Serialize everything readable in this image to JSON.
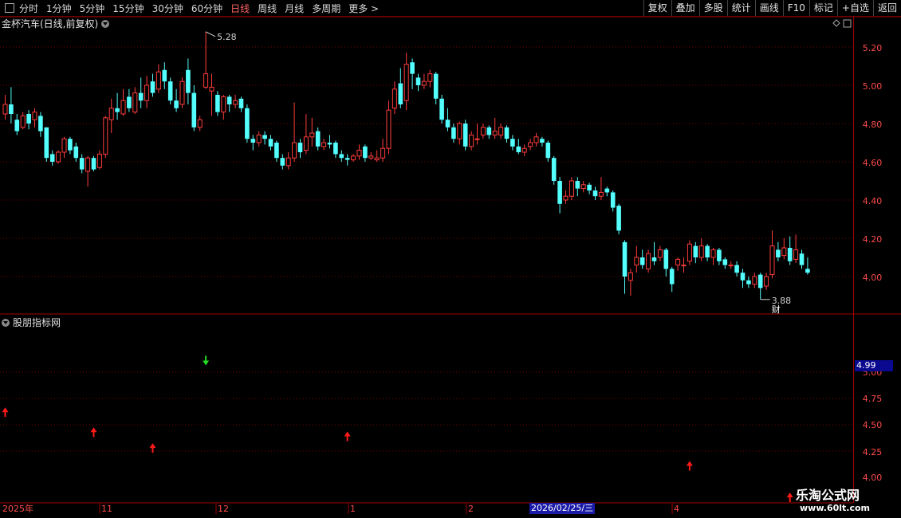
{
  "toolbar": {
    "periods": [
      "分时",
      "1分钟",
      "5分钟",
      "15分钟",
      "30分钟",
      "60分钟",
      "日线",
      "周线",
      "月线",
      "多周期",
      "更多 >"
    ],
    "active_period": "日线",
    "right_buttons": [
      "复权",
      "叠加",
      "多股",
      "统计",
      "画线",
      "F10",
      "标记",
      "+自选",
      "返回"
    ]
  },
  "chart_header": {
    "title": "金杯汽车(日线,前复权)"
  },
  "indicator_header": {
    "title": "股朋指标网"
  },
  "price_axis": {
    "labels": [
      "5.20",
      "5.00",
      "4.80",
      "4.60",
      "4.40",
      "4.20",
      "4.00"
    ]
  },
  "indicator_axis": {
    "labels": [
      "5.00",
      "4.75",
      "4.50",
      "4.25",
      "4.00"
    ],
    "current_value": "4.99"
  },
  "annotations": {
    "high": "5.28",
    "low": "3.88",
    "fin_tag": "财"
  },
  "time_axis": {
    "labels": [
      "2025年",
      "11",
      "12",
      "1",
      "2",
      "4"
    ],
    "cursor_date": "2026/02/25/三"
  },
  "watermark": {
    "name": "乐淘公式网",
    "url": "www.60lt.com"
  },
  "colors": {
    "up": "#ff3c3c",
    "down": "#54ffff",
    "grid": "#7a0000",
    "axis_line": "#a00000"
  },
  "chart_data": {
    "type": "candlestick",
    "ylim": [
      3.88,
      5.28
    ],
    "candles": [
      [
        4.85,
        4.9,
        4.82,
        4.95
      ],
      [
        4.9,
        4.85,
        4.8,
        4.99
      ],
      [
        4.82,
        4.76,
        4.74,
        4.85
      ],
      [
        4.78,
        4.84,
        4.77,
        4.86
      ],
      [
        4.85,
        4.8,
        4.77,
        4.87
      ],
      [
        4.82,
        4.86,
        4.78,
        4.88
      ],
      [
        4.84,
        4.76,
        4.73,
        4.86
      ],
      [
        4.78,
        4.62,
        4.6,
        4.78
      ],
      [
        4.64,
        4.6,
        4.58,
        4.66
      ],
      [
        4.6,
        4.65,
        4.59,
        4.66
      ],
      [
        4.65,
        4.72,
        4.62,
        4.73
      ],
      [
        4.72,
        4.66,
        4.64,
        4.73
      ],
      [
        4.68,
        4.62,
        4.6,
        4.7
      ],
      [
        4.62,
        4.56,
        4.54,
        4.64
      ],
      [
        4.55,
        4.62,
        4.47,
        4.63
      ],
      [
        4.62,
        4.56,
        4.55,
        4.63
      ],
      [
        4.57,
        4.64,
        4.56,
        4.66
      ],
      [
        4.64,
        4.83,
        4.62,
        4.84
      ],
      [
        4.82,
        4.88,
        4.75,
        4.93
      ],
      [
        4.88,
        4.86,
        4.82,
        4.96
      ],
      [
        4.85,
        4.92,
        4.84,
        4.98
      ],
      [
        4.94,
        4.88,
        4.86,
        4.98
      ],
      [
        4.86,
        4.96,
        4.85,
        4.99
      ],
      [
        4.96,
        4.92,
        4.88,
        5.04
      ],
      [
        4.92,
        5.0,
        4.88,
        5.05
      ],
      [
        5.02,
        4.96,
        4.94,
        5.06
      ],
      [
        4.98,
        5.07,
        4.96,
        5.11
      ],
      [
        5.08,
        5.02,
        4.98,
        5.12
      ],
      [
        5.02,
        4.92,
        4.9,
        5.04
      ],
      [
        4.92,
        4.88,
        4.86,
        4.98
      ],
      [
        4.9,
        5.02,
        4.88,
        5.04
      ],
      [
        5.08,
        4.96,
        4.9,
        5.14
      ],
      [
        4.96,
        4.78,
        4.76,
        5.0
      ],
      [
        4.78,
        4.82,
        4.76,
        4.84
      ],
      [
        4.99,
        5.06,
        4.98,
        5.28
      ],
      [
        4.97,
        4.99,
        4.84,
        5.06
      ],
      [
        4.95,
        4.86,
        4.84,
        4.97
      ],
      [
        4.86,
        4.94,
        4.82,
        4.95
      ],
      [
        4.94,
        4.9,
        4.86,
        4.95
      ],
      [
        4.9,
        4.92,
        4.88,
        4.95
      ],
      [
        4.93,
        4.88,
        4.86,
        4.94
      ],
      [
        4.88,
        4.72,
        4.7,
        4.9
      ],
      [
        4.72,
        4.7,
        4.66,
        4.74
      ],
      [
        4.7,
        4.74,
        4.68,
        4.76
      ],
      [
        4.74,
        4.72,
        4.69,
        4.76
      ],
      [
        4.72,
        4.68,
        4.66,
        4.74
      ],
      [
        4.7,
        4.62,
        4.6,
        4.71
      ],
      [
        4.62,
        4.58,
        4.56,
        4.64
      ],
      [
        4.58,
        4.62,
        4.56,
        4.65
      ],
      [
        4.62,
        4.7,
        4.6,
        4.91
      ],
      [
        4.7,
        4.65,
        4.62,
        4.72
      ],
      [
        4.66,
        4.73,
        4.64,
        4.85
      ],
      [
        4.73,
        4.75,
        4.68,
        4.83
      ],
      [
        4.76,
        4.68,
        4.66,
        4.78
      ],
      [
        4.68,
        4.7,
        4.66,
        4.72
      ],
      [
        4.7,
        4.69,
        4.67,
        4.74
      ],
      [
        4.7,
        4.64,
        4.62,
        4.71
      ],
      [
        4.64,
        4.62,
        4.6,
        4.66
      ],
      [
        4.62,
        4.61,
        4.58,
        4.64
      ],
      [
        4.61,
        4.63,
        4.6,
        4.64
      ],
      [
        4.63,
        4.66,
        4.61,
        4.69
      ],
      [
        4.68,
        4.62,
        4.6,
        4.69
      ],
      [
        4.62,
        4.63,
        4.61,
        4.65
      ],
      [
        4.61,
        4.62,
        4.6,
        4.66
      ],
      [
        4.62,
        4.67,
        4.6,
        4.72
      ],
      [
        4.67,
        4.87,
        4.64,
        4.92
      ],
      [
        4.88,
        4.98,
        4.85,
        5.02
      ],
      [
        5.01,
        4.9,
        4.88,
        5.09
      ],
      [
        4.92,
        5.11,
        4.87,
        5.17
      ],
      [
        5.12,
        5.06,
        4.98,
        5.14
      ],
      [
        5.04,
        5.0,
        4.97,
        5.06
      ],
      [
        5.0,
        5.02,
        4.98,
        5.06
      ],
      [
        5.02,
        5.06,
        4.99,
        5.08
      ],
      [
        5.06,
        4.93,
        4.9,
        5.07
      ],
      [
        4.93,
        4.82,
        4.8,
        4.95
      ],
      [
        4.82,
        4.78,
        4.76,
        4.88
      ],
      [
        4.78,
        4.72,
        4.7,
        4.8
      ],
      [
        4.72,
        4.8,
        4.69,
        4.81
      ],
      [
        4.8,
        4.68,
        4.66,
        4.82
      ],
      [
        4.68,
        4.74,
        4.66,
        4.76
      ],
      [
        4.72,
        4.72,
        4.69,
        4.8
      ],
      [
        4.74,
        4.78,
        4.72,
        4.8
      ],
      [
        4.78,
        4.74,
        4.72,
        4.79
      ],
      [
        4.74,
        4.76,
        4.72,
        4.83
      ],
      [
        4.74,
        4.78,
        4.72,
        4.8
      ],
      [
        4.78,
        4.72,
        4.7,
        4.79
      ],
      [
        4.72,
        4.68,
        4.66,
        4.74
      ],
      [
        4.68,
        4.65,
        4.64,
        4.72
      ],
      [
        4.65,
        4.67,
        4.63,
        4.69
      ],
      [
        4.68,
        4.7,
        4.66,
        4.72
      ],
      [
        4.7,
        4.73,
        4.68,
        4.75
      ],
      [
        4.72,
        4.7,
        4.68,
        4.73
      ],
      [
        4.7,
        4.62,
        4.6,
        4.71
      ],
      [
        4.62,
        4.5,
        4.48,
        4.63
      ],
      [
        4.5,
        4.38,
        4.33,
        4.52
      ],
      [
        4.4,
        4.42,
        4.38,
        4.45
      ],
      [
        4.42,
        4.5,
        4.4,
        4.52
      ],
      [
        4.5,
        4.46,
        4.42,
        4.52
      ],
      [
        4.46,
        4.48,
        4.44,
        4.5
      ],
      [
        4.48,
        4.45,
        4.43,
        4.49
      ],
      [
        4.45,
        4.42,
        4.4,
        4.47
      ],
      [
        4.42,
        4.44,
        4.4,
        4.52
      ],
      [
        4.46,
        4.44,
        4.42,
        4.47
      ],
      [
        4.44,
        4.36,
        4.34,
        4.45
      ],
      [
        4.37,
        4.24,
        4.22,
        4.38
      ],
      [
        4.18,
        4.0,
        3.91,
        4.19
      ],
      [
        3.98,
        4.02,
        3.9,
        4.04
      ],
      [
        4.06,
        4.1,
        4.02,
        4.16
      ],
      [
        4.1,
        4.06,
        4.04,
        4.14
      ],
      [
        4.04,
        4.12,
        4.02,
        4.14
      ],
      [
        4.1,
        4.08,
        4.06,
        4.18
      ],
      [
        4.1,
        4.14,
        4.08,
        4.16
      ],
      [
        4.14,
        4.04,
        4.0,
        4.15
      ],
      [
        4.04,
        3.96,
        3.92,
        4.05
      ],
      [
        4.06,
        4.09,
        4.03,
        4.1
      ],
      [
        4.06,
        4.06,
        4.02,
        4.1
      ],
      [
        4.08,
        4.17,
        4.06,
        4.19
      ],
      [
        4.16,
        4.1,
        4.07,
        4.18
      ],
      [
        4.1,
        4.16,
        4.08,
        4.2
      ],
      [
        4.16,
        4.1,
        4.08,
        4.17
      ],
      [
        4.1,
        4.14,
        4.06,
        4.15
      ],
      [
        4.14,
        4.08,
        4.06,
        4.15
      ],
      [
        4.09,
        4.06,
        4.04,
        4.1
      ],
      [
        4.06,
        4.06,
        4.04,
        4.08
      ],
      [
        4.06,
        4.02,
        4.0,
        4.08
      ],
      [
        4.02,
        3.98,
        3.94,
        4.04
      ],
      [
        3.98,
        3.96,
        3.94,
        4.0
      ],
      [
        3.96,
        4.0,
        3.94,
        4.02
      ],
      [
        4.01,
        3.94,
        3.88,
        4.02
      ],
      [
        3.95,
        4.0,
        3.93,
        4.02
      ],
      [
        4.01,
        4.16,
        3.99,
        4.24
      ],
      [
        4.14,
        4.1,
        4.08,
        4.18
      ],
      [
        4.11,
        4.15,
        4.09,
        4.2
      ],
      [
        4.15,
        4.08,
        4.06,
        4.21
      ],
      [
        4.09,
        4.14,
        4.07,
        4.22
      ],
      [
        4.12,
        4.06,
        4.04,
        4.14
      ],
      [
        4.04,
        4.02,
        4.01,
        4.1
      ]
    ],
    "signals_up": [
      {
        "i": 0,
        "v": 4.65
      },
      {
        "i": 15,
        "v": 4.46
      },
      {
        "i": 25,
        "v": 4.31
      },
      {
        "i": 58,
        "v": 4.42
      },
      {
        "i": 116,
        "v": 4.14
      },
      {
        "i": 133,
        "v": 3.84
      }
    ],
    "signals_down": [
      {
        "i": 34,
        "v": 5.08
      }
    ]
  }
}
